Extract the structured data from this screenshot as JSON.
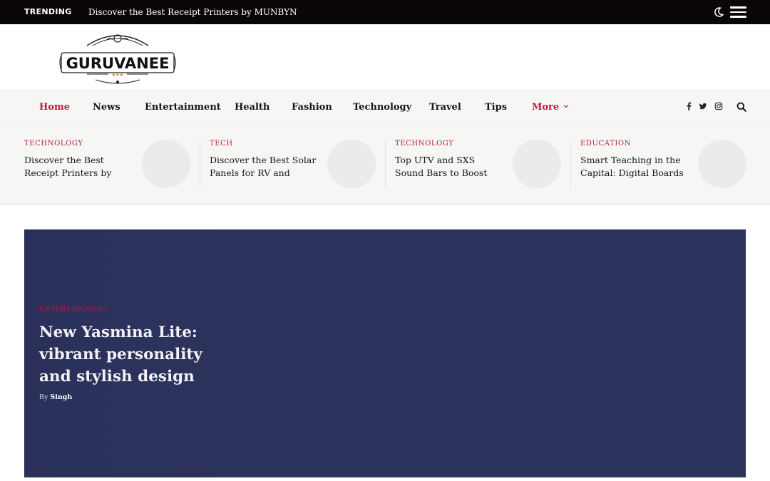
{
  "topbar": {
    "trending_label": "TRENDING",
    "trending_text": "Discover the Best Receipt Printers by MUNBYN",
    "icons": [
      "moon-icon",
      "menu-icon"
    ]
  },
  "logo": {
    "text": "GURUVANEE"
  },
  "nav": {
    "items": [
      {
        "label": "Home",
        "active": true
      },
      {
        "label": "News"
      },
      {
        "label": "Entertainment"
      },
      {
        "label": "Health"
      },
      {
        "label": "Fashion"
      },
      {
        "label": "Technology"
      },
      {
        "label": "Travel"
      },
      {
        "label": "Tips"
      },
      {
        "label": "More",
        "active": true,
        "dropdown": true
      }
    ],
    "social_icons": [
      "facebook-icon",
      "twitter-icon",
      "instagram-icon"
    ],
    "search_icon": "search-icon",
    "accent_color": "#c3183d"
  },
  "strip": [
    {
      "category": "TECHNOLOGY",
      "title": "Discover the Best Receipt Printers by MUNBYN"
    },
    {
      "category": "TECH",
      "title": "Discover the Best Solar Panels for RV and Reliabl..."
    },
    {
      "category": "TECHNOLOGY",
      "title": "Top UTV and SXS Sound Bars to Boost Your Off-..."
    },
    {
      "category": "EDUCATION",
      "title": "Smart Teaching in the Capital: Digital Boards fo..."
    }
  ],
  "hero": {
    "category": "ENTERTAINMENT",
    "title": "New Yasmina Lite: vibrant personality and stylish design",
    "by_prefix": "By",
    "author": "Singh",
    "background_color": "#2c335d"
  }
}
